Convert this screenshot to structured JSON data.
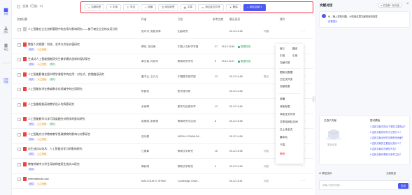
{
  "sidebar": {
    "items": [
      {
        "label": "文献",
        "icon": "book-icon"
      },
      {
        "label": "研究",
        "icon": "flask-icon"
      },
      {
        "label": "笔记",
        "icon": "note-icon"
      }
    ],
    "vertical_label": "任务列表"
  },
  "toolbar": {
    "select_all": "全选（已选：1）",
    "buttons": [
      "文献标签",
      "引用",
      "导出",
      "收藏",
      "添加标签",
      "文章",
      "添加至文件夹",
      "删除"
    ],
    "primary": "添加文献 ∨"
  },
  "table": {
    "headers": {
      "title": "文献标题",
      "author": "作者",
      "source": "刊名",
      "refs": "参考文献",
      "time": "最近阅读",
      "ops": "操作"
    },
    "rows": [
      {
        "title": "人工智能在企业创新管理中的应用与影响研究——基于商业企业的实证分析",
        "tags": [],
        "pdf": "gray",
        "author": "张可可, 吴航伟等",
        "source": "出版研究",
        "refs": "",
        "time": "05-12 16:56",
        "ops_note": "问题",
        "status": "",
        "ops": [
          "问题"
        ]
      },
      {
        "title": "数智人文视野：科技、艺术与文化价值研究",
        "tags": [
          {
            "t": "研究",
            "c": ""
          },
          {
            "t": "人工智能",
            "c": "y"
          }
        ],
        "pdf": "red",
        "author": "傅伟, 张佳瑜",
        "source": "中国人文科学学报",
        "refs": "27",
        "time": "05-12 16:56",
        "status": "数据完成",
        "ops": []
      },
      {
        "title": "生成式人工智能赋能研究生教学模式创新的现状研究",
        "tags": [
          {
            "t": "研究",
            "c": ""
          },
          {
            "t": "人工智能",
            "c": "y"
          },
          {
            "t": "教育",
            "c": "g"
          }
        ],
        "pdf": "red",
        "author": "黄文菊, 何伟华",
        "source": "教育研究学刊",
        "refs": "5",
        "time": "05-13 11:57",
        "status": "数据完成",
        "ops": []
      },
      {
        "title": "人工智能影像在图书馆学课程中的应用：对方式、实践路径研究",
        "tags": [
          {
            "t": "研究",
            "c": ""
          },
          {
            "t": "人工智能",
            "c": "y"
          },
          {
            "t": "教育",
            "c": "g"
          }
        ],
        "pdf": "red",
        "author": "董书云, 王凡凡",
        "source": "中国图书馆学报",
        "refs": "13",
        "time": "05-12 16:56",
        "status": "",
        "ops": [
          "笔记"
        ]
      },
      {
        "title": "人工智能技术在教育数字化领域中的应用研究",
        "tags": [],
        "pdf": "red",
        "author": "陈昌权",
        "source": "图书馆刊物",
        "refs": "",
        "time": "05-12 16:56",
        "status": "",
        "ops": []
      },
      {
        "title": "人工智能赋能高校教学设计的探索研究",
        "tags": [],
        "pdf": "red",
        "author": "余雨晴",
        "source": "图书与信息科学",
        "refs": "13",
        "time": "05-12 16:56",
        "status": "",
        "ops": []
      },
      {
        "title": "人工智能教学与学习深度融合对教学的推动研究",
        "tags": [
          {
            "t": "研究",
            "c": ""
          },
          {
            "t": "人工智能",
            "c": "y"
          },
          {
            "t": "教育",
            "c": "g"
          }
        ],
        "pdf": "red",
        "author": "葛丽丽, 俞丽丽",
        "source": "教育研究与应用",
        "refs": "8",
        "time": "05-12 16:56",
        "status": "",
        "ops": []
      },
      {
        "title": "人工智能对大学教育教学思政教育的影响与对策研究",
        "tags": [
          {
            "t": "研究",
            "c": ""
          },
          {
            "t": "人工智能",
            "c": "y"
          }
        ],
        "pdf": "red",
        "author": "范乐康",
        "source": "MEDIA COMMUNI...",
        "refs": "",
        "time": "05-12 16:56",
        "status": "",
        "ops": []
      },
      {
        "title": "论生成式AI技术：人工智能对学习的影响研究",
        "tags": [
          {
            "t": "研究",
            "c": ""
          },
          {
            "t": "人工智能",
            "c": "y"
          }
        ],
        "pdf": "red",
        "author": "江雪尊",
        "source": "教育文学研究",
        "refs": "16",
        "time": "05-12 16:56",
        "status": "",
        "ops": [
          "问答"
        ]
      },
      {
        "title": "教育领域中大学生采纳和使用生成式AI研究",
        "tags": [
          {
            "t": "研究",
            "c": ""
          }
        ],
        "pdf": "red",
        "author": "周秋明",
        "source": "教育文学研究",
        "refs": "4",
        "time": "05-12 16:56",
        "status": "",
        "ops": [
          "问答"
        ]
      },
      {
        "title": "International Law",
        "tags": [
          {
            "t": "研究",
            "c": ""
          },
          {
            "t": "人工智能",
            "c": "y"
          }
        ],
        "pdf": "red",
        "author": "MALCOLM N. SHAW",
        "source": "Cambridge Unive...",
        "refs": "",
        "time": "05-12 16:51",
        "status": "",
        "ops": [
          "问答"
        ]
      }
    ]
  },
  "context_menu": {
    "left": [
      "释义",
      "中英",
      "文献问答",
      "",
      "更新元数据",
      "已在文件夹",
      "文献信息",
      "",
      "收藏",
      "添加标签",
      "添加至文件夹",
      "共享至团队空间",
      "已上传全文",
      "重命名",
      "下载",
      "删除"
    ],
    "right": [
      "翻译",
      "引用"
    ]
  },
  "right_panel": {
    "title": "文献对话",
    "top_button": "开启新一轮对话",
    "greeting": "Hi，输入您的问题，AI将用这里文献的库的回答",
    "greeting_link": "查看提示",
    "card_left_title": "已选中文献",
    "card_right_title": "提问模板",
    "empty_text": "暂无记录",
    "questions": [
      "1.这篇文献中提出了哪些主要观点？",
      "2.这篇文献的研究方法是什么？",
      "3.这篇文献对研究问题有何贡献？",
      "4.这篇文献的主要结论是什么？",
      "5.这篇文献存在哪些不足？",
      "6.这篇文献有哪些可参考之处？"
    ],
    "bottom_left": "AI 模型选择",
    "bottom_right": "文献数量",
    "input_placeholder": "请输入您的问题...",
    "send_label": "发送"
  }
}
